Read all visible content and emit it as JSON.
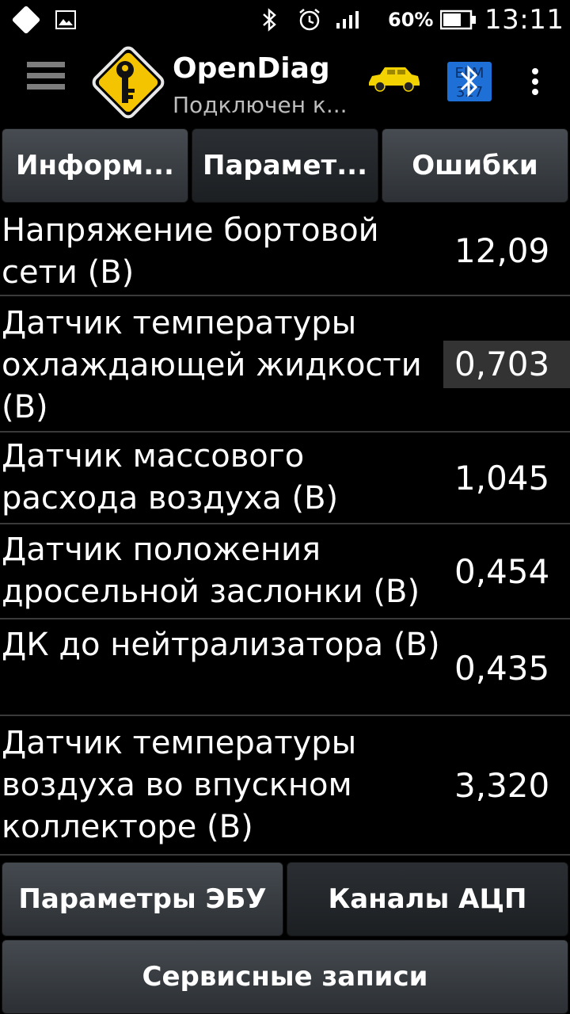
{
  "statusbar": {
    "battery_percent": "60%",
    "time": "13:11"
  },
  "appbar": {
    "title": "OpenDiag",
    "subtitle": "Подключен к..."
  },
  "tabs": [
    {
      "label": "Информ..."
    },
    {
      "label": "Парамет..."
    },
    {
      "label": "Ошибки"
    }
  ],
  "params": [
    {
      "label": "Напряжение бортовой сети (В)",
      "value": "12,09"
    },
    {
      "label": "Датчик температуры охлаждающей жидкости (В)",
      "value": "0,703"
    },
    {
      "label": "Датчик массового расхода воздуха (В)",
      "value": "1,045"
    },
    {
      "label": "Датчик положения дросельной заслонки (В)",
      "value": "0,454"
    },
    {
      "label": "ДК до нейтрализатора (В)",
      "value": "0,435"
    },
    {
      "label": "Датчик температуры воздуха во впускном коллекторе (В)",
      "value": "3,320"
    }
  ],
  "buttons": {
    "ecu_params": "Параметры ЭБУ",
    "adc_channels": "Каналы АЦП",
    "service_records": "Сервисные записи"
  },
  "colors": {
    "logo_yellow": "#f5c400",
    "car_yellow": "#f2d200",
    "bt_blue": "#1e6fd6"
  }
}
